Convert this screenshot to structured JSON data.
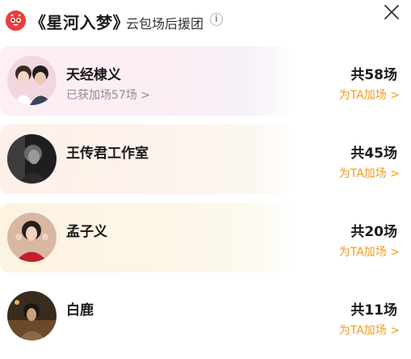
{
  "header": {
    "title": "《星河入梦》",
    "subtitle": "云包场后援团",
    "info_icon": "info-icon",
    "close_icon": "close-icon",
    "logo": "red-mascot-logo"
  },
  "list": [
    {
      "name": "天经棣义",
      "note": "已获加场57场 >",
      "count": "共58场",
      "boost": "为TA加场 >",
      "avatar": "couple-photo-avatar"
    },
    {
      "name": "王传君工作室",
      "note": "",
      "count": "共45场",
      "boost": "为TA加场 >",
      "avatar": "dark-portrait-avatar"
    },
    {
      "name": "孟子义",
      "note": "",
      "count": "共20场",
      "boost": "为TA加场 >",
      "avatar": "red-dress-avatar"
    },
    {
      "name": "白鹿",
      "note": "",
      "count": "共11场",
      "boost": "为TA加场 >",
      "avatar": "warm-scene-avatar"
    }
  ],
  "colors": {
    "accent_orange": "#f29b1a",
    "logo_red": "#ef3b3b",
    "text_primary": "#1a1a1a",
    "text_secondary": "#8c8c8c"
  }
}
